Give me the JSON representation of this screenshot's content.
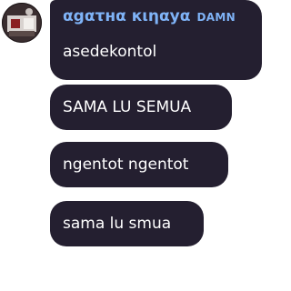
{
  "chat": {
    "sender": {
      "name": "αgατнα кιηαуα",
      "badge": "DAMN",
      "name_color": "#7fb3f7"
    },
    "bubble_color": "#241f30",
    "messages": [
      {
        "text": "asedekontol"
      },
      {
        "text": "SAMA LU SEMUA"
      },
      {
        "text": "ngentot ngentot"
      },
      {
        "text": "sama lu smua"
      }
    ]
  }
}
